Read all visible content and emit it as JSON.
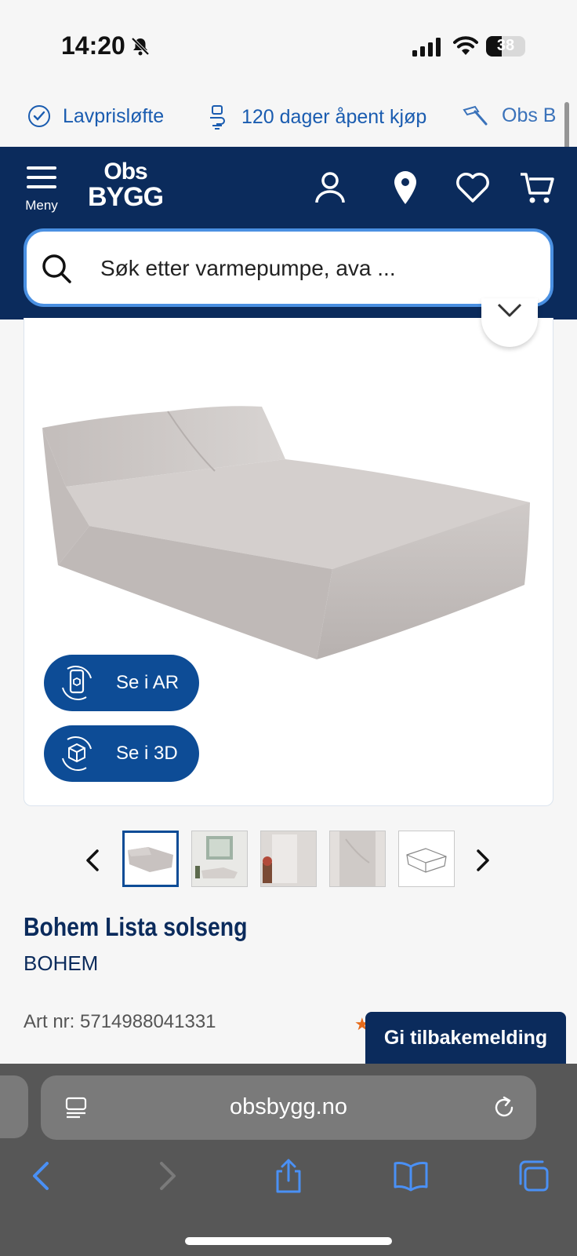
{
  "status": {
    "time": "14:20",
    "battery": "38"
  },
  "usp": [
    {
      "label": "Lavprisløfte",
      "icon": "checkmark-circle-icon"
    },
    {
      "label": "120 dager åpent kjøp",
      "icon": "return-box-icon"
    },
    {
      "label": "Obs B",
      "icon": "hammer-icon"
    }
  ],
  "header": {
    "menu_label": "Meny",
    "logo_line1": "Obs",
    "logo_line2": "BYGG",
    "icons": [
      "user-icon",
      "location-pin-icon",
      "heart-icon",
      "cart-icon"
    ]
  },
  "search": {
    "placeholder": "Søk etter varmepumpe, ava ..."
  },
  "product": {
    "view_buttons": [
      {
        "label": "Se i AR",
        "icon": "ar-phone-icon"
      },
      {
        "label": "Se i 3D",
        "icon": "cube-3d-icon"
      }
    ],
    "thumbnail_count": 5,
    "active_thumbnail": 1,
    "title": "Bohem Lista solseng",
    "brand": "BOHEM",
    "art_nr": "Art nr: 5714988041331"
  },
  "feedback": {
    "label": "Gi tilbakemelding"
  },
  "browser": {
    "url": "obsbygg.no",
    "toolbar_icons": [
      "back-icon",
      "forward-icon",
      "share-icon",
      "bookmarks-icon",
      "tabs-icon"
    ]
  },
  "colors": {
    "brand_navy": "#0b2b5c",
    "brand_blue": "#0d4c96",
    "link_blue": "#1a5cb0"
  }
}
